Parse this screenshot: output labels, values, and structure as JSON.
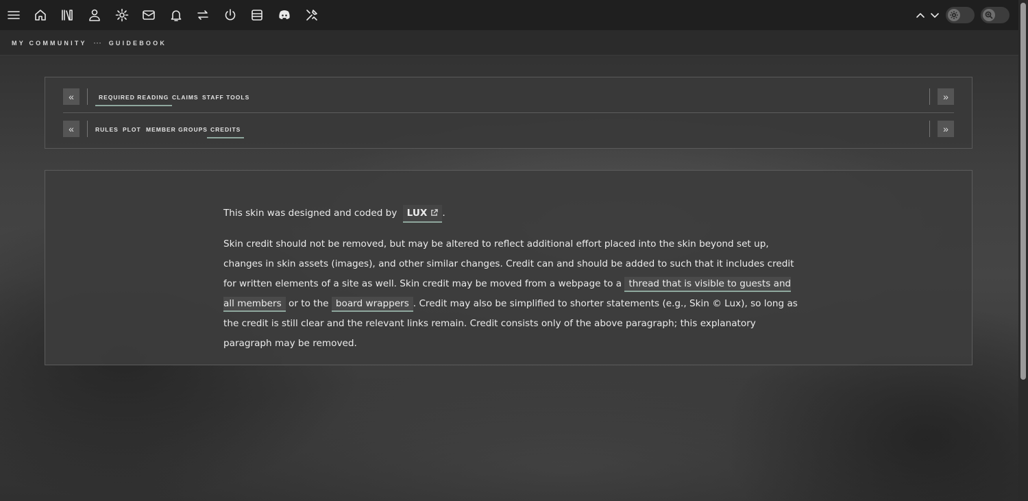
{
  "topbar": {
    "icons": [
      "menu-icon",
      "home-icon",
      "library-icon",
      "user-icon",
      "gear-icon",
      "mail-icon",
      "bell-icon",
      "swap-icon",
      "power-icon",
      "archive-icon",
      "discord-icon",
      "tools-icon"
    ],
    "right_icons": [
      "chevron-up-icon",
      "chevron-down-icon"
    ],
    "toggles": [
      "theme-toggle",
      "zoom-toggle"
    ]
  },
  "breadcrumb": {
    "home": "MY COMMUNITY",
    "separator": "···",
    "current": "GUIDEBOOK"
  },
  "tabs_primary": [
    {
      "label": "REQUIRED READING",
      "active": true
    },
    {
      "label": "CLAIMS",
      "active": false
    },
    {
      "label": "STAFF TOOLS",
      "active": false
    }
  ],
  "tabs_secondary": [
    {
      "label": "RULES",
      "active": false
    },
    {
      "label": "PLOT",
      "active": false
    },
    {
      "label": "MEMBER GROUPS",
      "active": false
    },
    {
      "label": "CREDITS",
      "active": true
    }
  ],
  "content": {
    "p1_before": "This skin was designed and coded by",
    "p1_link": "LUX",
    "p1_after": ".",
    "p2_part1": "Skin credit should not be removed, but may be altered to reflect additional effort placed into the skin beyond set up, changes in skin assets (images), and other similar changes. Credit can and should be added to such that it includes credit for written elements of a site as well. Skin credit may be moved from a webpage to a",
    "p2_link1": "thread that is visible to guests and all members",
    "p2_mid": "or to the",
    "p2_link2": "board wrappers",
    "p2_part2": ". Credit may also be simplified to shorter statements (e.g., Skin © Lux), so long as the credit is still clear and the relevant links remain. Credit consists only of the above paragraph; this explanatory paragraph may be removed."
  },
  "colors": {
    "accent": "#8fa89e",
    "topbar": "#1f1f1f",
    "panel": "#3c3c3c"
  }
}
